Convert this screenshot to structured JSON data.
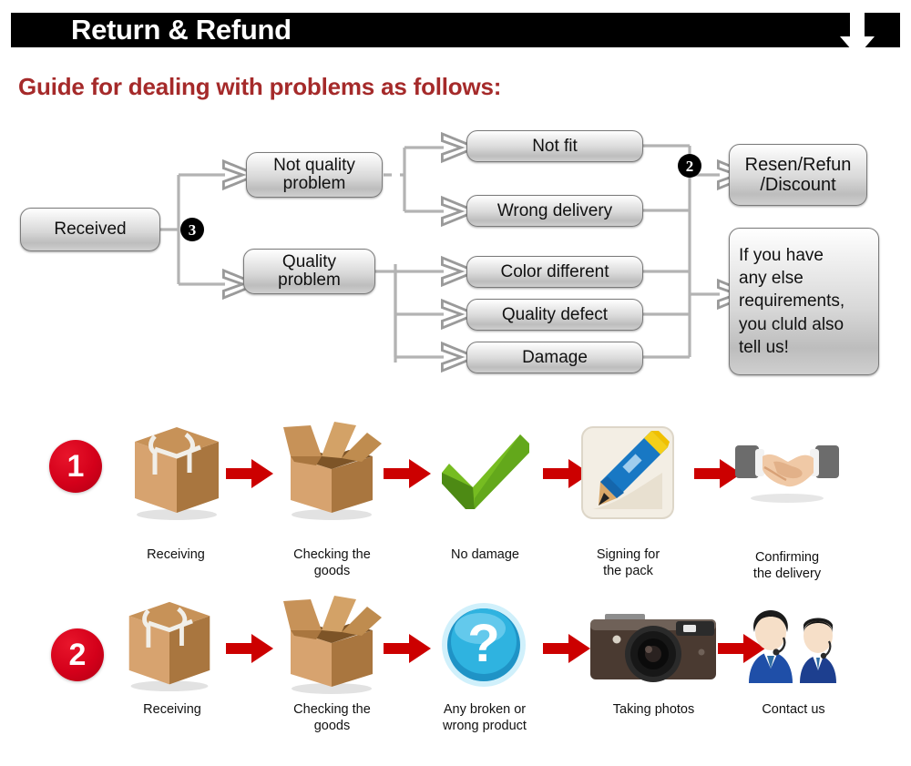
{
  "header": {
    "title": "Return & Refund",
    "arrow_icon": "down-arrow-icon",
    "bar_color": "#000000",
    "text_color": "#ffffff"
  },
  "guide": {
    "title": "Guide for dealing with problems as follows:",
    "color": "#A52A2A"
  },
  "flowchart": {
    "markers": [
      {
        "label": "3",
        "name": "flow-marker-3"
      },
      {
        "label": "2",
        "name": "flow-marker-2"
      }
    ],
    "nodes": {
      "received": "Received",
      "not_quality_problem": "Not quality\nproblem",
      "quality_problem": "Quality\nproblem",
      "not_fit": "Not fit",
      "wrong_delivery": "Wrong delivery",
      "color_different": "Color different",
      "quality_defect": "Quality defect",
      "damage": "Damage",
      "resend_refund_discount": "Resen/Refun\n/Discount",
      "any_else": "If you have\nany else\nrequirements,\nyou cluld also\ntell us!"
    }
  },
  "process_rows": [
    {
      "number": "1",
      "number_color": "#D4001A",
      "steps": [
        {
          "icon": "closed-box-icon",
          "label": "Receiving"
        },
        {
          "icon": "open-box-icon",
          "label": "Checking the\ngoods"
        },
        {
          "icon": "green-check-icon",
          "label": "No damage"
        },
        {
          "icon": "pencil-signing-icon",
          "label": "Signing for\nthe pack"
        },
        {
          "icon": "handshake-icon",
          "label": "Confirming\nthe delivery"
        }
      ],
      "arrow_icon": "red-right-arrow-icon"
    },
    {
      "number": "2",
      "number_color": "#D4001A",
      "steps": [
        {
          "icon": "closed-box-icon",
          "label": "Receiving"
        },
        {
          "icon": "open-box-icon",
          "label": "Checking the\ngoods"
        },
        {
          "icon": "blue-question-icon",
          "label": "Any broken or\nwrong product"
        },
        {
          "icon": "camera-icon",
          "label": "Taking photos"
        },
        {
          "icon": "support-agents-icon",
          "label": "Contact us"
        }
      ],
      "arrow_icon": "red-right-arrow-icon"
    }
  ]
}
